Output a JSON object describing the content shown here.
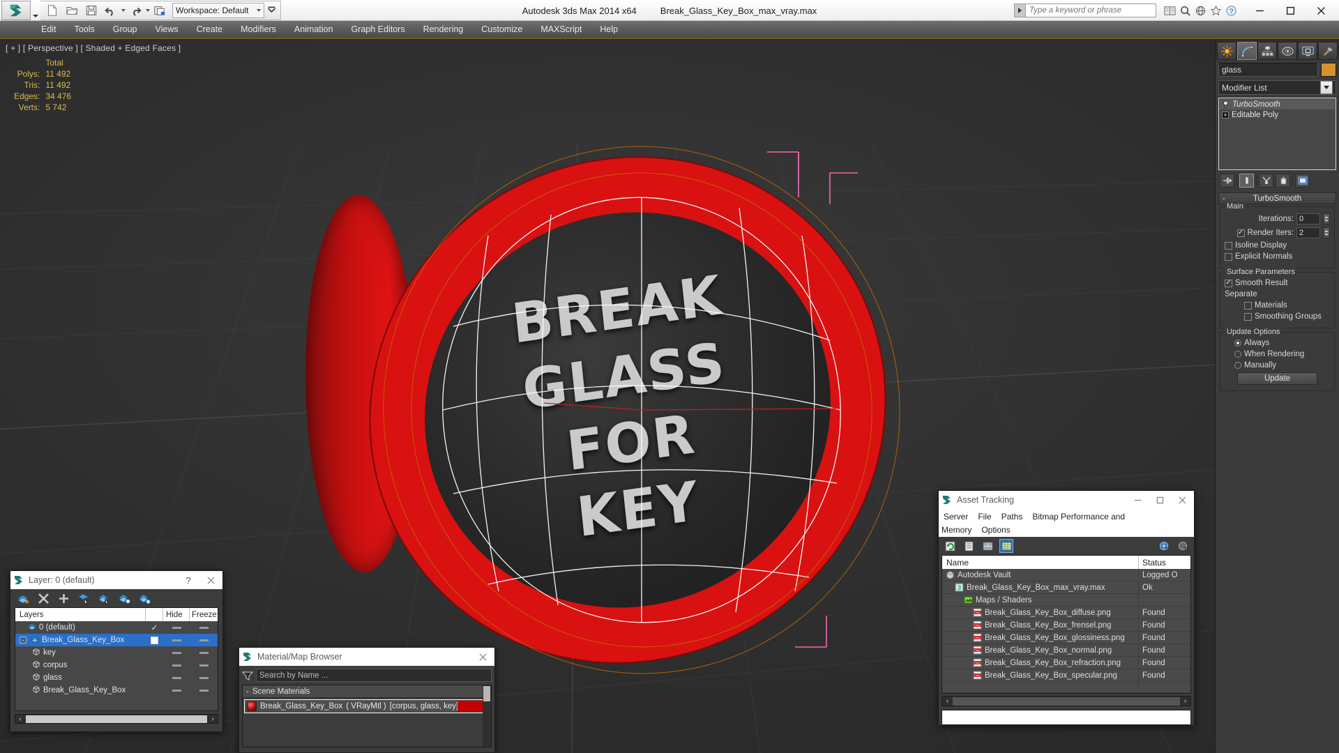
{
  "titlebar": {
    "app_title": "Autodesk 3ds Max  2014 x64",
    "file_title": "Break_Glass_Key_Box_max_vray.max",
    "workspace_label": "Workspace: Default",
    "search_placeholder": "Type a keyword or phrase",
    "quick_access": [
      {
        "name": "new-file-icon",
        "label": "New"
      },
      {
        "name": "open-file-icon",
        "label": "Open"
      },
      {
        "name": "save-file-icon",
        "label": "Save"
      },
      {
        "name": "undo-icon",
        "label": "Undo"
      },
      {
        "name": "redo-icon",
        "label": "Redo"
      },
      {
        "name": "project-folder-icon",
        "label": "Set Project Folder"
      }
    ],
    "window_buttons": [
      "minimize",
      "maximize",
      "close"
    ]
  },
  "menubar": {
    "items": [
      "Edit",
      "Tools",
      "Group",
      "Views",
      "Create",
      "Modifiers",
      "Animation",
      "Graph Editors",
      "Rendering",
      "Customize",
      "MAXScript",
      "Help"
    ]
  },
  "viewport": {
    "label": "[ + ] [ Perspective ] [ Shaded + Edged Faces ]",
    "stats": {
      "header": "Total",
      "rows": [
        {
          "label": "Polys:",
          "value": "11 492"
        },
        {
          "label": "Tris:",
          "value": "11 492"
        },
        {
          "label": "Edges:",
          "value": "34 476"
        },
        {
          "label": "Verts:",
          "value": "5 742"
        }
      ]
    },
    "object_text": {
      "line1": "BREAK",
      "line2": "GLASS",
      "line3": "FOR",
      "line4": "KEY"
    },
    "object_color": "#d91111"
  },
  "command_panel": {
    "tabs": [
      {
        "name": "create-tab",
        "icon": "star-icon",
        "active": false
      },
      {
        "name": "modify-tab",
        "icon": "curve-icon",
        "active": true
      },
      {
        "name": "hierarchy-tab",
        "icon": "hierarchy-icon",
        "active": false
      },
      {
        "name": "motion-tab",
        "icon": "motion-icon",
        "active": false
      },
      {
        "name": "display-tab",
        "icon": "display-icon",
        "active": false
      },
      {
        "name": "utilities-tab",
        "icon": "hammer-icon",
        "active": false
      }
    ],
    "object_name": "glass",
    "object_color": "#d8912e",
    "modifier_list_label": "Modifier List",
    "stack": [
      {
        "label": "TurboSmooth",
        "italic": true,
        "selected": true
      },
      {
        "label": "Editable Poly",
        "italic": false,
        "selected": false
      }
    ],
    "stack_tools": [
      "pin-stack-icon",
      "show-end-result-icon",
      "make-unique-icon",
      "remove-modifier-icon",
      "configure-sets-icon"
    ],
    "rollout": {
      "title": "TurboSmooth",
      "groups": {
        "main": {
          "title": "Main",
          "iterations_label": "Iterations:",
          "iterations_value": "0",
          "render_iters_label": "Render Iters:",
          "render_iters_value": "2",
          "render_iters_checked": true,
          "isoline_label": "Isoline Display",
          "isoline_checked": false,
          "explicit_label": "Explicit Normals",
          "explicit_checked": false
        },
        "surface": {
          "title": "Surface Parameters",
          "smooth_result_label": "Smooth Result",
          "smooth_result_checked": true,
          "separate_label": "Separate",
          "materials_label": "Materials",
          "materials_checked": false,
          "smoothing_groups_label": "Smoothing Groups",
          "smoothing_groups_checked": false
        },
        "update": {
          "title": "Update Options",
          "always_label": "Always",
          "when_rendering_label": "When Rendering",
          "manually_label": "Manually",
          "selected": "Always",
          "update_button_label": "Update"
        }
      }
    }
  },
  "layer_dialog": {
    "title": "Layer: 0 (default)",
    "help_label": "?",
    "close_label": "✕",
    "toolbar": [
      "new-layer-icon",
      "delete-layer-icon",
      "add-layer-icon",
      "select-objects-icon",
      "select-highlighted-icon",
      "highlight-selected-icon",
      "layer-properties-icon"
    ],
    "columns": {
      "name": "Layers",
      "hide": "Hide",
      "freeze": "Freeze"
    },
    "rows": [
      {
        "name": "0 (default)",
        "indent": 0,
        "icon": "layer-icon",
        "checked": "check",
        "selected": false,
        "expander": false
      },
      {
        "name": "Break_Glass_Key_Box",
        "indent": 0,
        "icon": "layer-icon",
        "checked": "box",
        "selected": true,
        "expander": true
      },
      {
        "name": "key",
        "indent": 1,
        "icon": "object-icon",
        "checked": "",
        "selected": false,
        "expander": false
      },
      {
        "name": "corpus",
        "indent": 1,
        "icon": "object-icon",
        "checked": "",
        "selected": false,
        "expander": false
      },
      {
        "name": "glass",
        "indent": 1,
        "icon": "object-icon",
        "checked": "",
        "selected": false,
        "expander": false
      },
      {
        "name": "Break_Glass_Key_Box",
        "indent": 1,
        "icon": "object-icon",
        "checked": "",
        "selected": false,
        "expander": false
      }
    ]
  },
  "matmap_dialog": {
    "title": "Material/Map Browser",
    "close_label": "✕",
    "search_placeholder": "Search by Name ...",
    "group_label": "Scene Materials",
    "group_collapse": "-",
    "item": {
      "name": "Break_Glass_Key_Box",
      "type": "( VRayMtl )",
      "assigned": "[corpus, glass, key]",
      "swatch_color": "#c40000"
    }
  },
  "asset_dialog": {
    "title": "Asset Tracking",
    "menu": [
      "Server",
      "File",
      "Paths",
      "Bitmap Performance and Memory",
      "Options"
    ],
    "toolbar": [
      "refresh-icon",
      "list-view-icon",
      "detail-view-icon",
      "table-view-icon"
    ],
    "toolbar_right": [
      "vault-login-icon",
      "vault-logout-icon"
    ],
    "columns": {
      "name": "Name",
      "status": "Status"
    },
    "rows": [
      {
        "name": "Autodesk Vault",
        "status": "Logged O",
        "indent": 0,
        "icon": "vault-icon"
      },
      {
        "name": "Break_Glass_Key_Box_max_vray.max",
        "status": "Ok",
        "indent": 1,
        "icon": "max-file-icon"
      },
      {
        "name": "Maps / Shaders",
        "status": "",
        "indent": 2,
        "icon": "maps-icon"
      },
      {
        "name": "Break_Glass_Key_Box_diffuse.png",
        "status": "Found",
        "indent": 3,
        "icon": "png-icon"
      },
      {
        "name": "Break_Glass_Key_Box_frensel.png",
        "status": "Found",
        "indent": 3,
        "icon": "png-icon"
      },
      {
        "name": "Break_Glass_Key_Box_glossiness.png",
        "status": "Found",
        "indent": 3,
        "icon": "png-icon"
      },
      {
        "name": "Break_Glass_Key_Box_normal.png",
        "status": "Found",
        "indent": 3,
        "icon": "png-icon"
      },
      {
        "name": "Break_Glass_Key_Box_refraction.png",
        "status": "Found",
        "indent": 3,
        "icon": "png-icon"
      },
      {
        "name": "Break_Glass_Key_Box_specular.png",
        "status": "Found",
        "indent": 3,
        "icon": "png-icon"
      }
    ]
  }
}
